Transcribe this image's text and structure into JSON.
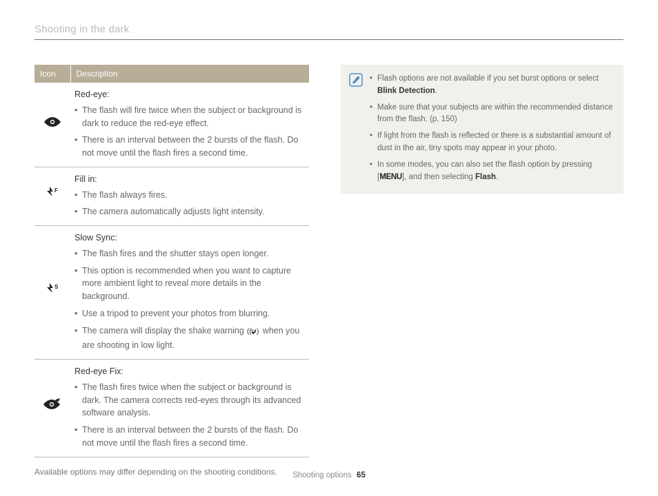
{
  "page_title": "Shooting in the dark",
  "table": {
    "head": {
      "icon": "Icon",
      "desc": "Description"
    },
    "rows": [
      {
        "icon_name": "red-eye-icon",
        "title": "Red-eye",
        "bullets": [
          "The flash will fire twice when the subject or background is dark to reduce the red-eye effect.",
          "There is an interval between the 2 bursts of the flash. Do not move until the flash fires a second time."
        ]
      },
      {
        "icon_name": "fill-in-icon",
        "title": "Fill in",
        "bullets": [
          "The flash always fires.",
          "The camera automatically adjusts light intensity."
        ]
      },
      {
        "icon_name": "slow-sync-icon",
        "title": "Slow Sync",
        "bullets": [
          "The flash fires and the shutter stays open longer.",
          "This option is recommended when you want to capture more ambient light to reveal more details in the background.",
          "Use a tripod to prevent your photos from blurring.",
          "The camera will display the shake warning {{SHAKE}} when you are shooting in low light."
        ]
      },
      {
        "icon_name": "red-eye-fix-icon",
        "title": "Red-eye Fix",
        "bullets": [
          "The flash fires twice when the subject or background is dark. The camera corrects red-eyes through its advanced software analysis.",
          "There is an interval between the 2 bursts of the flash. Do not move until the flash fires a second time."
        ]
      }
    ]
  },
  "footnote": "Available options may differ depending on the shooting conditions.",
  "notes": {
    "items": [
      {
        "pre": "Flash options are not available if you set burst options or select ",
        "bold": "Blink Detection",
        "post": "."
      },
      {
        "text": "Make sure that your subjects are within the recommended distance from the flash. (p. 150)"
      },
      {
        "text": "If light from the flash is reflected or there is a substantial amount of dust in the air, tiny spots may appear in your photo."
      },
      {
        "pre": "In some modes, you can also set the flash option by pressing [",
        "menu": "MENU",
        "mid": "], and then selecting ",
        "bold": "Flash",
        "post": "."
      }
    ]
  },
  "footer": {
    "section": "Shooting options",
    "page": "65"
  }
}
